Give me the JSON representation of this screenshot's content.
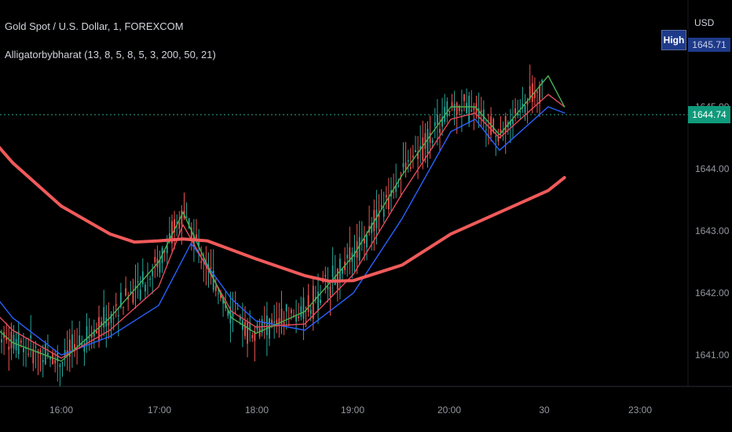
{
  "header": {
    "title": "Gold Spot / U.S. Dollar, 1, FOREXCOM",
    "indicator": "Alligatorbybharat (13, 8, 5, 8, 5, 3, 200, 50, 21)"
  },
  "price_axis": {
    "currency": "USD",
    "high_label": "High",
    "high_value": "1645.71",
    "current_price": "1644.74"
  },
  "chart_data": {
    "type": "line",
    "x_ticks": [
      "16:00",
      "17:00",
      "18:00",
      "19:00",
      "20:00",
      "30",
      "23:00"
    ],
    "y_ticks": [
      "1645.00",
      "1644.00",
      "1643.00",
      "1642.00",
      "1641.00"
    ],
    "ylim": [
      1640.7,
      1645.9
    ],
    "current_price": 1644.74,
    "series": [
      {
        "color": "#f05a5a",
        "role": "200-period MA",
        "x": [
          "15:00",
          "15:30",
          "16:00",
          "16:30",
          "16:45",
          "17:00",
          "17:15",
          "17:30",
          "18:00",
          "18:30",
          "18:45",
          "19:00",
          "19:30",
          "20:00",
          "20:30",
          "21:00",
          "21:10"
        ],
        "values": [
          1645.0,
          1644.1,
          1643.4,
          1642.95,
          1642.82,
          1642.84,
          1642.87,
          1642.84,
          1642.55,
          1642.28,
          1642.19,
          1642.2,
          1642.45,
          1642.95,
          1643.3,
          1643.65,
          1643.86
        ]
      },
      {
        "color": "#2962ff",
        "role": "Alligator jaw",
        "x": [
          "15:00",
          "15:30",
          "16:00",
          "16:30",
          "17:00",
          "17:20",
          "17:45",
          "18:00",
          "18:30",
          "19:00",
          "19:30",
          "20:00",
          "20:15",
          "20:30",
          "21:00",
          "21:10"
        ],
        "values": [
          1642.6,
          1641.6,
          1641.0,
          1641.3,
          1641.8,
          1642.8,
          1641.9,
          1641.55,
          1641.4,
          1642.0,
          1643.2,
          1644.6,
          1644.8,
          1644.3,
          1645.0,
          1644.9
        ]
      },
      {
        "color": "#e54a5c",
        "role": "Alligator teeth",
        "x": [
          "15:00",
          "15:30",
          "16:00",
          "16:30",
          "17:00",
          "17:15",
          "17:45",
          "18:00",
          "18:30",
          "19:00",
          "19:30",
          "20:00",
          "20:15",
          "20:30",
          "21:00",
          "21:10"
        ],
        "values": [
          1642.2,
          1641.4,
          1640.95,
          1641.4,
          1642.1,
          1643.1,
          1641.7,
          1641.45,
          1641.5,
          1642.3,
          1643.6,
          1644.8,
          1644.9,
          1644.5,
          1645.2,
          1645.0
        ]
      },
      {
        "color": "#4caf50",
        "role": "Alligator lips",
        "x": [
          "15:00",
          "15:30",
          "16:00",
          "16:30",
          "17:00",
          "17:15",
          "17:45",
          "18:00",
          "18:30",
          "19:00",
          "19:30",
          "20:00",
          "20:15",
          "20:30",
          "21:00",
          "21:10"
        ],
        "values": [
          1641.9,
          1641.2,
          1640.9,
          1641.6,
          1642.5,
          1643.3,
          1641.6,
          1641.35,
          1641.7,
          1642.6,
          1643.9,
          1645.0,
          1645.0,
          1644.55,
          1645.5,
          1645.0
        ]
      }
    ]
  }
}
